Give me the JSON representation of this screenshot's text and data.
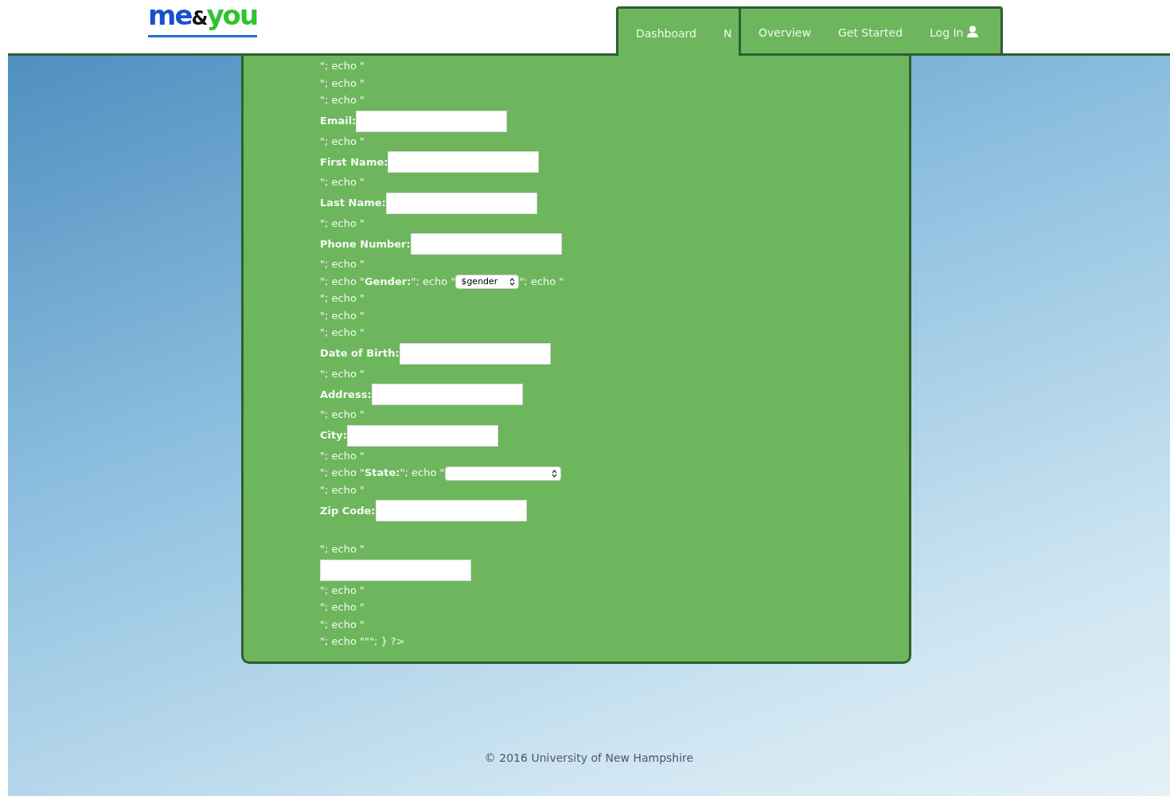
{
  "logo": {
    "parts": [
      "me",
      "&",
      "you"
    ]
  },
  "nav_back": [
    {
      "label": "Dashboard"
    },
    {
      "label": "N"
    }
  ],
  "nav_front": [
    {
      "label": "Overview",
      "kind": "text"
    },
    {
      "label": "Get Started",
      "kind": "text"
    },
    {
      "label": "Log In",
      "kind": "user"
    }
  ],
  "form": [
    {
      "kind": "echo",
      "text": "\"; echo \""
    },
    {
      "kind": "echo",
      "text": "\"; echo \""
    },
    {
      "kind": "echo",
      "text": "\"; echo \""
    },
    {
      "kind": "field",
      "label": "Email:"
    },
    {
      "kind": "echo",
      "text": "\"; echo \""
    },
    {
      "kind": "field",
      "label": "First Name:"
    },
    {
      "kind": "echo",
      "text": "\"; echo \""
    },
    {
      "kind": "field",
      "label": "Last Name:"
    },
    {
      "kind": "echo",
      "text": "\"; echo \""
    },
    {
      "kind": "field",
      "label": "Phone Number:"
    },
    {
      "kind": "echo",
      "text": "\"; echo \""
    },
    {
      "kind": "select",
      "before": "\"; echo \"**Gender:**\"; echo \"",
      "value": "$gender",
      "after": "\"; echo \""
    },
    {
      "kind": "echo",
      "text": "\"; echo \""
    },
    {
      "kind": "echo",
      "text": "\"; echo \""
    },
    {
      "kind": "echo",
      "text": "\"; echo \""
    },
    {
      "kind": "field",
      "label": "Date of Birth:"
    },
    {
      "kind": "echo",
      "text": "\"; echo \""
    },
    {
      "kind": "field",
      "label": "Address:"
    },
    {
      "kind": "echo",
      "text": "\"; echo \""
    },
    {
      "kind": "field",
      "label": "City:"
    },
    {
      "kind": "echo",
      "text": "\"; echo \""
    },
    {
      "kind": "select",
      "before": "\"; echo \"**State:**\"; echo \""
    },
    {
      "kind": "echo",
      "text": "\"; echo \""
    },
    {
      "kind": "field",
      "label": "Zip Code:"
    },
    {
      "kind": "echo",
      "text": "\"; echo \"",
      "gap": true
    },
    {
      "kind": "input"
    },
    {
      "kind": "echo",
      "text": "\"; echo \""
    },
    {
      "kind": "echo",
      "text": "\"; echo \""
    },
    {
      "kind": "echo",
      "text": "\"; echo \""
    },
    {
      "kind": "echo",
      "text": "\"; echo \"\"\"; } ?>"
    }
  ],
  "footer": "© 2016 University of New Hampshire"
}
